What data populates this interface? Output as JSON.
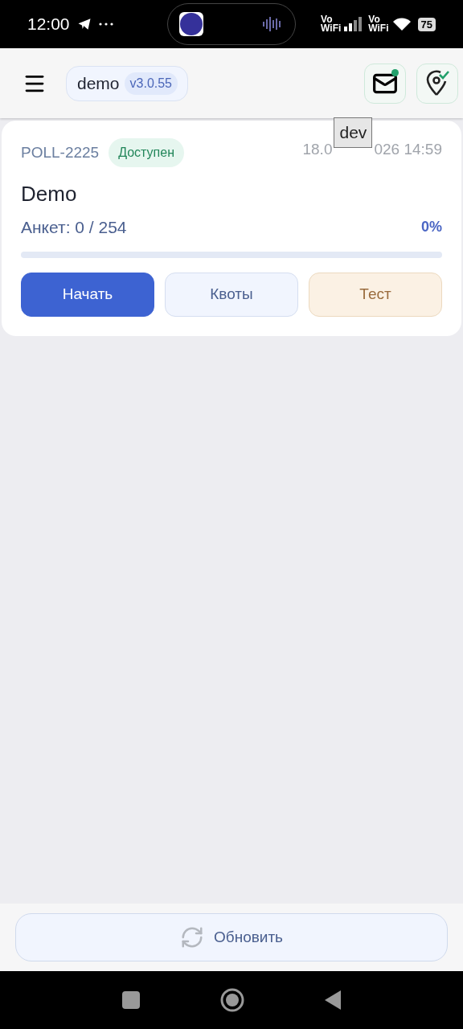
{
  "status_bar": {
    "time": "12:00",
    "signal_labels": [
      "Vo\nWiFi",
      "Vo\nWiFi"
    ],
    "battery": "75"
  },
  "header": {
    "app_name": "demo",
    "version": "v3.0.55",
    "mail_unread": true,
    "location_ok": true
  },
  "tooltip": {
    "text": "dev"
  },
  "polls": [
    {
      "id": "POLL-2225",
      "status": "Доступен",
      "date_start": "18.0",
      "date_end": "026 14:59",
      "title": "Demo",
      "progress_label": "Анкет: 0 / 254",
      "percent": "0%",
      "level": 0,
      "buttons": [
        {
          "label": "Начать",
          "kind": "primary"
        },
        {
          "label": "Квоты",
          "kind": "secondary"
        },
        {
          "label": "Тест",
          "kind": "test"
        }
      ]
    }
  ],
  "footer": {
    "refresh_label": "Обновить"
  }
}
